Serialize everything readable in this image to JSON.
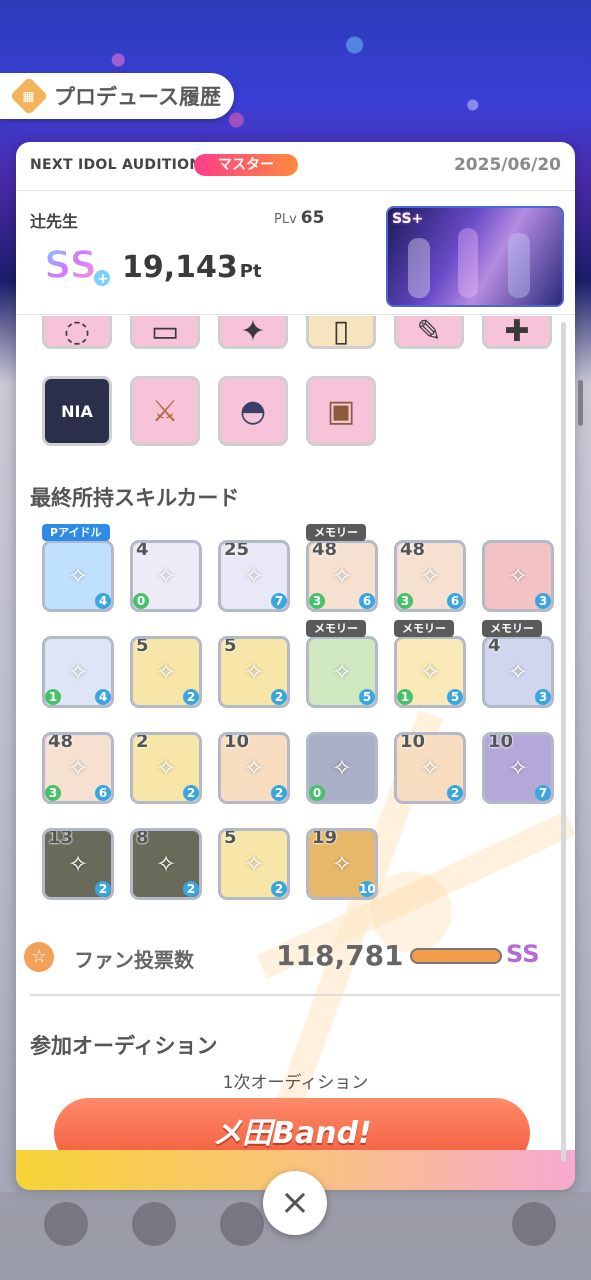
{
  "header": {
    "icon": "ticket-icon",
    "title": "プロデュース履歴"
  },
  "audition": {
    "name": "NEXT IDOL AUDITION",
    "difficulty": "マスター",
    "date": "2025/06/20"
  },
  "producer": {
    "idol_name": "辻先生",
    "plv_label": "PLv",
    "plv_value": "65",
    "rank": "SS+",
    "score": "19,143",
    "score_unit": "Pt",
    "thumbnail_rank": "SS+"
  },
  "items_partial": [
    "ring-icon",
    "paper-icon",
    "ribbon-icon",
    "jar-icon",
    "note-icon",
    "plus-icon"
  ],
  "items": [
    {
      "icon": "nia-card-icon",
      "text": "NIA"
    },
    {
      "icon": "sword-icon",
      "text": ""
    },
    {
      "icon": "cap-icon",
      "text": ""
    },
    {
      "icon": "giftbox-icon",
      "text": ""
    }
  ],
  "skill_section_title": "最終所持スキルカード",
  "skill_cards": [
    {
      "tag": "Pアイドル",
      "cost": "",
      "bl": "",
      "br": "4",
      "color": "#bfe0ff"
    },
    {
      "tag": "",
      "cost": "4",
      "bl": "0",
      "br": "",
      "color": "#eeeaf7"
    },
    {
      "tag": "",
      "cost": "25",
      "bl": "",
      "br": "7",
      "color": "#e8e8f7"
    },
    {
      "tag": "メモリー",
      "cost": "48",
      "bl": "3",
      "br": "6",
      "color": "#f6e1d0"
    },
    {
      "tag": "",
      "cost": "48",
      "bl": "3",
      "br": "6",
      "color": "#f6e1d0"
    },
    {
      "tag": "",
      "cost": "",
      "bl": "",
      "br": "3",
      "color": "#f4c2c2"
    },
    {
      "tag": "",
      "cost": "",
      "bl": "1",
      "br": "4",
      "color": "#dfe5f7"
    },
    {
      "tag": "",
      "cost": "5",
      "bl": "",
      "br": "2",
      "color": "#f7e6a8"
    },
    {
      "tag": "",
      "cost": "5",
      "bl": "",
      "br": "2",
      "color": "#f7e6a8"
    },
    {
      "tag": "メモリー",
      "cost": "",
      "bl": "",
      "br": "5",
      "color": "#cfe8c0"
    },
    {
      "tag": "メモリー",
      "cost": "",
      "bl": "1",
      "br": "5",
      "color": "#f9e9b8"
    },
    {
      "tag": "メモリー",
      "cost": "4",
      "bl": "",
      "br": "3",
      "color": "#cfd6ee"
    },
    {
      "tag": "",
      "cost": "48",
      "bl": "3",
      "br": "6",
      "color": "#f6e1d0"
    },
    {
      "tag": "",
      "cost": "2",
      "bl": "",
      "br": "2",
      "color": "#f7e6a8"
    },
    {
      "tag": "",
      "cost": "10",
      "bl": "",
      "br": "2",
      "color": "#f8ddc0"
    },
    {
      "tag": "",
      "cost": "",
      "bl": "0",
      "br": "",
      "color": "#a9afc4"
    },
    {
      "tag": "",
      "cost": "10",
      "bl": "",
      "br": "2",
      "color": "#f8ddc0"
    },
    {
      "tag": "",
      "cost": "10",
      "bl": "",
      "br": "7",
      "color": "#b4a8d8"
    },
    {
      "tag": "",
      "cost": "13",
      "bl": "",
      "br": "2",
      "color": "#6a6a5a"
    },
    {
      "tag": "",
      "cost": "8",
      "bl": "",
      "br": "2",
      "color": "#6a6a5a"
    },
    {
      "tag": "",
      "cost": "5",
      "bl": "",
      "br": "2",
      "color": "#f7e6a8"
    },
    {
      "tag": "",
      "cost": "19",
      "bl": "",
      "br": "10",
      "color": "#e8b86a"
    }
  ],
  "fan_votes": {
    "label": "ファン投票数",
    "value": "118,781",
    "rank": "SS",
    "bar_fill": 1.0
  },
  "audition_section": {
    "title": "参加オーディション",
    "round": "1次オーディション",
    "banner": "メ田Band!"
  },
  "close_button": "×"
}
